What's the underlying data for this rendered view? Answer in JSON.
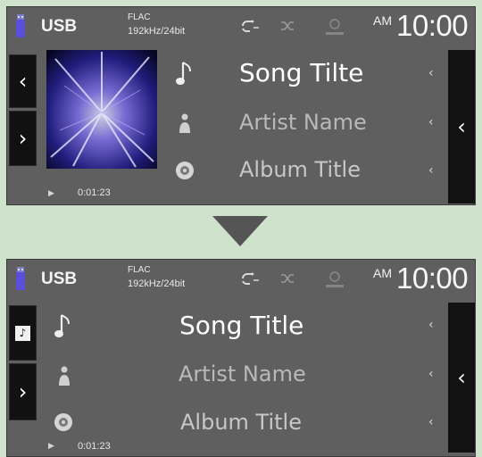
{
  "before": {
    "status": {
      "source": "USB",
      "codec": "FLAC",
      "rate": "192kHz/24bit",
      "ampm": "AM",
      "time": "10:00"
    },
    "track": {
      "title": "Song Tilte",
      "artist": "Artist Name",
      "album": "Album Title"
    },
    "elapsed": "0:01:23",
    "buttons": {
      "prev": "‹",
      "expand": "›",
      "right": "‹"
    },
    "icons": [
      "usb-icon",
      "music-note-icon",
      "artist-icon",
      "album-icon",
      "repeat-icon",
      "shuffle-icon",
      "disc-icon",
      "play-icon"
    ]
  },
  "after": {
    "status": {
      "source": "USB",
      "codec": "FLAC",
      "rate": "192kHz/24bit",
      "ampm": "AM",
      "time": "10:00"
    },
    "track": {
      "title": "Song Title",
      "artist": "Artist Name",
      "album": "Album Title"
    },
    "elapsed": "0:01:23",
    "buttons": {
      "expand": "›",
      "right": "‹"
    }
  },
  "colors": {
    "page_bg": "#cfe3cc",
    "panel_bg": "#5f5f5f",
    "button_bg": "#111111",
    "arrow": "#555555"
  }
}
